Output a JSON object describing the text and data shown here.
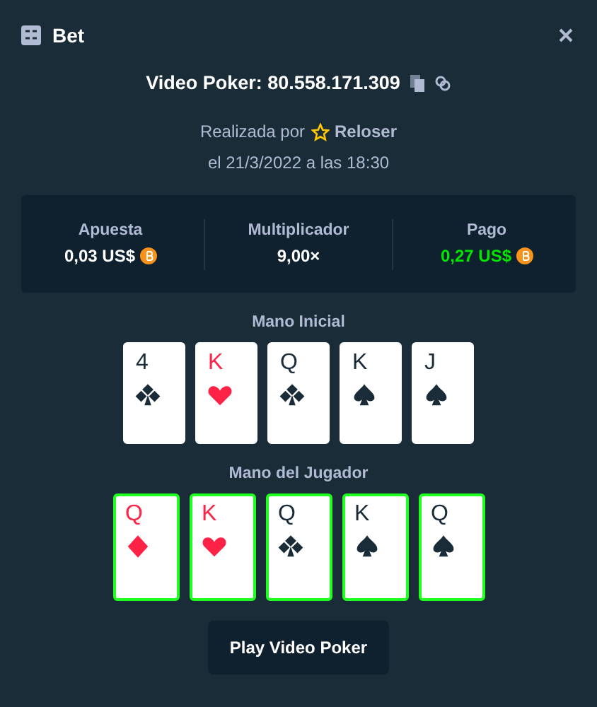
{
  "window": {
    "title": "Bet"
  },
  "bet": {
    "game": "Video Poker: 80.558.171.309",
    "placed_by_label": "Realizada por",
    "user": "Reloser",
    "date": "el 21/3/2022 a las 18:30"
  },
  "stats": [
    {
      "label": "Apuesta",
      "value": "0,03 US$",
      "coin": true,
      "win": false
    },
    {
      "label": "Multiplicador",
      "value": "9,00×",
      "coin": false,
      "win": false
    },
    {
      "label": "Pago",
      "value": "0,27 US$",
      "coin": true,
      "win": true
    }
  ],
  "hands": [
    {
      "title": "Mano Inicial",
      "cards": [
        {
          "rank": "4",
          "kind": "clubs",
          "highlighted": false
        },
        {
          "rank": "K",
          "kind": "hearts",
          "highlighted": false
        },
        {
          "rank": "Q",
          "kind": "clubs",
          "highlighted": false
        },
        {
          "rank": "K",
          "kind": "spades",
          "highlighted": false
        },
        {
          "rank": "J",
          "kind": "spades",
          "highlighted": false
        }
      ]
    },
    {
      "title": "Mano del Jugador",
      "cards": [
        {
          "rank": "Q",
          "kind": "diamonds",
          "highlighted": true
        },
        {
          "rank": "K",
          "kind": "hearts",
          "highlighted": true
        },
        {
          "rank": "Q",
          "kind": "clubs",
          "highlighted": true
        },
        {
          "rank": "K",
          "kind": "spades",
          "highlighted": true
        },
        {
          "rank": "Q",
          "kind": "spades",
          "highlighted": true
        }
      ]
    }
  ],
  "play_button": "Play Video Poker"
}
